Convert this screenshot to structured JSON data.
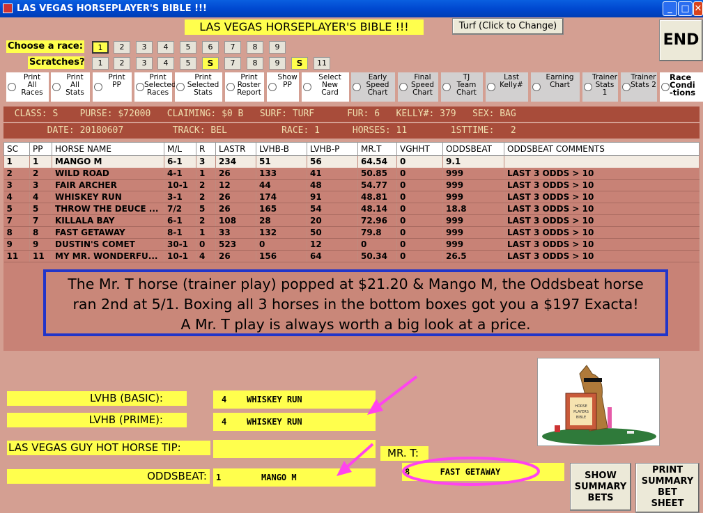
{
  "window": {
    "title": "LAS VEGAS HORSEPLAYER'S BIBLE !!!"
  },
  "header": {
    "banner": "LAS VEGAS HORSEPLAYER'S BIBLE !!!",
    "turf_button": "Turf (Click to Change)",
    "end_button": "END"
  },
  "race_select": {
    "label": "Choose  a race:",
    "races": [
      "1",
      "2",
      "3",
      "4",
      "5",
      "6",
      "7",
      "8",
      "9"
    ],
    "selected": "1"
  },
  "scratches": {
    "label": "Scratches?",
    "items": [
      "1",
      "2",
      "3",
      "4",
      "5",
      "S",
      "7",
      "8",
      "9",
      "S",
      "11"
    ]
  },
  "options": [
    {
      "label": "Print\nAll\nRaces",
      "style": "white"
    },
    {
      "label": "Print\nAll\nStats",
      "style": "white"
    },
    {
      "label": "Print\nPP",
      "style": "white"
    },
    {
      "label": "Print\nSelected\nRaces",
      "style": "white"
    },
    {
      "label": "Print\nSelected\nStats",
      "style": "white"
    },
    {
      "label": "Print\nRoster\nReport",
      "style": "white"
    },
    {
      "label": "Show\nPP",
      "style": "white"
    },
    {
      "label": "Select\nNew\nCard",
      "style": "white"
    },
    {
      "label": "Early\nSpeed\nChart",
      "style": "gray"
    },
    {
      "label": "Final\nSpeed\nChart",
      "style": "gray"
    },
    {
      "label": "TJ\nTeam\nChart",
      "style": "gray"
    },
    {
      "label": "Last\nKelly#",
      "style": "gray"
    },
    {
      "label": "Earning\nChart",
      "style": "gray"
    },
    {
      "label": "Trainer\nStats 1",
      "style": "gray"
    },
    {
      "label": "Trainer\nStats 2",
      "style": "gray"
    },
    {
      "label": "Race\nCondi\n-tions",
      "style": "white"
    }
  ],
  "info": {
    "line1": "  CLASS: S    PURSE: $72000   CLAIMING: $0 B   SURF: TURF      FUR: 6   KELLY#: 379   SEX: BAG",
    "line2": "        DATE: 20180607         TRACK: BEL          RACE: 1      HORSES: 11        1STTIME:   2"
  },
  "table": {
    "columns": [
      "SC",
      "PP",
      "HORSE NAME",
      "M/L",
      "R",
      "LASTR",
      "LVHB-B",
      "LVHB-P",
      "MR.T",
      "VGHHT",
      "ODDSBEAT",
      "ODDSBEAT COMMENTS"
    ],
    "rows": [
      [
        "1",
        "1",
        "MANGO M",
        "6-1",
        "3",
        "234",
        "51",
        "56",
        "64.54",
        "0",
        "9.1",
        ""
      ],
      [
        "2",
        "2",
        "WILD ROAD",
        "4-1",
        "1",
        "26",
        "133",
        "41",
        "50.85",
        "0",
        "999",
        "LAST 3 ODDS > 10"
      ],
      [
        "3",
        "3",
        "FAIR ARCHER",
        "10-1",
        "2",
        "12",
        "44",
        "48",
        "54.77",
        "0",
        "999",
        "LAST 3 ODDS > 10"
      ],
      [
        "4",
        "4",
        "WHISKEY RUN",
        "3-1",
        "2",
        "26",
        "174",
        "91",
        "48.81",
        "0",
        "999",
        "LAST 3 ODDS > 10"
      ],
      [
        "5",
        "5",
        "THROW THE DEUCE ...",
        "7/2",
        "5",
        "26",
        "165",
        "54",
        "48.14",
        "0",
        "18.8",
        "LAST 3 ODDS > 10"
      ],
      [
        "7",
        "7",
        "KILLALA BAY",
        "6-1",
        "2",
        "108",
        "28",
        "20",
        "72.96",
        "0",
        "999",
        "LAST 3 ODDS > 10"
      ],
      [
        "8",
        "8",
        "FAST GETAWAY",
        "8-1",
        "1",
        "33",
        "132",
        "50",
        "79.8",
        "0",
        "999",
        "LAST 3 ODDS > 10"
      ],
      [
        "9",
        "9",
        "DUSTIN'S COMET",
        "30-1",
        "0",
        "523",
        "0",
        "12",
        "0",
        "0",
        "999",
        "LAST 3 ODDS > 10"
      ],
      [
        "11",
        "11",
        "MY MR. WONDERFU...",
        "10-1",
        "4",
        "26",
        "156",
        "64",
        "50.34",
        "0",
        "26.5",
        "LAST 3 ODDS > 10"
      ]
    ]
  },
  "note": {
    "line1": "The Mr. T horse (trainer play) popped at $21.20 & Mango M, the Oddsbeat horse",
    "line2": "ran 2nd at 5/1.  Boxing all 3 horses in the bottom boxes got you a $197 Exacta!",
    "line3": "A Mr. T play is always worth a big look at a price."
  },
  "bottom": {
    "basic_label": "LVHB (BASIC):",
    "basic_value": "4    WHISKEY RUN",
    "prime_label": "LVHB (PRIME):",
    "prime_value": "4    WHISKEY RUN",
    "hot_label": "LAS VEGAS GUY HOT HORSE TIP:",
    "hot_value": "",
    "oddsbeat_label": "ODDSBEAT:",
    "oddsbeat_value": "1        MANGO M",
    "mrt_label": "MR. T:",
    "mrt_value": "8      FAST GETAWAY",
    "show_summary": "SHOW\nSUMMARY\nBETS",
    "print_summary": "PRINT\nSUMMARY\nBET\nSHEET"
  },
  "logo": {
    "text": "HORSE PLAYERS BIBLE"
  },
  "colors": {
    "background": "#d49f92",
    "highlight": "#ffff4d",
    "info_bar": "#a84c3a",
    "annotation_border": "#2135c9",
    "arrow": "#ff44ee"
  }
}
